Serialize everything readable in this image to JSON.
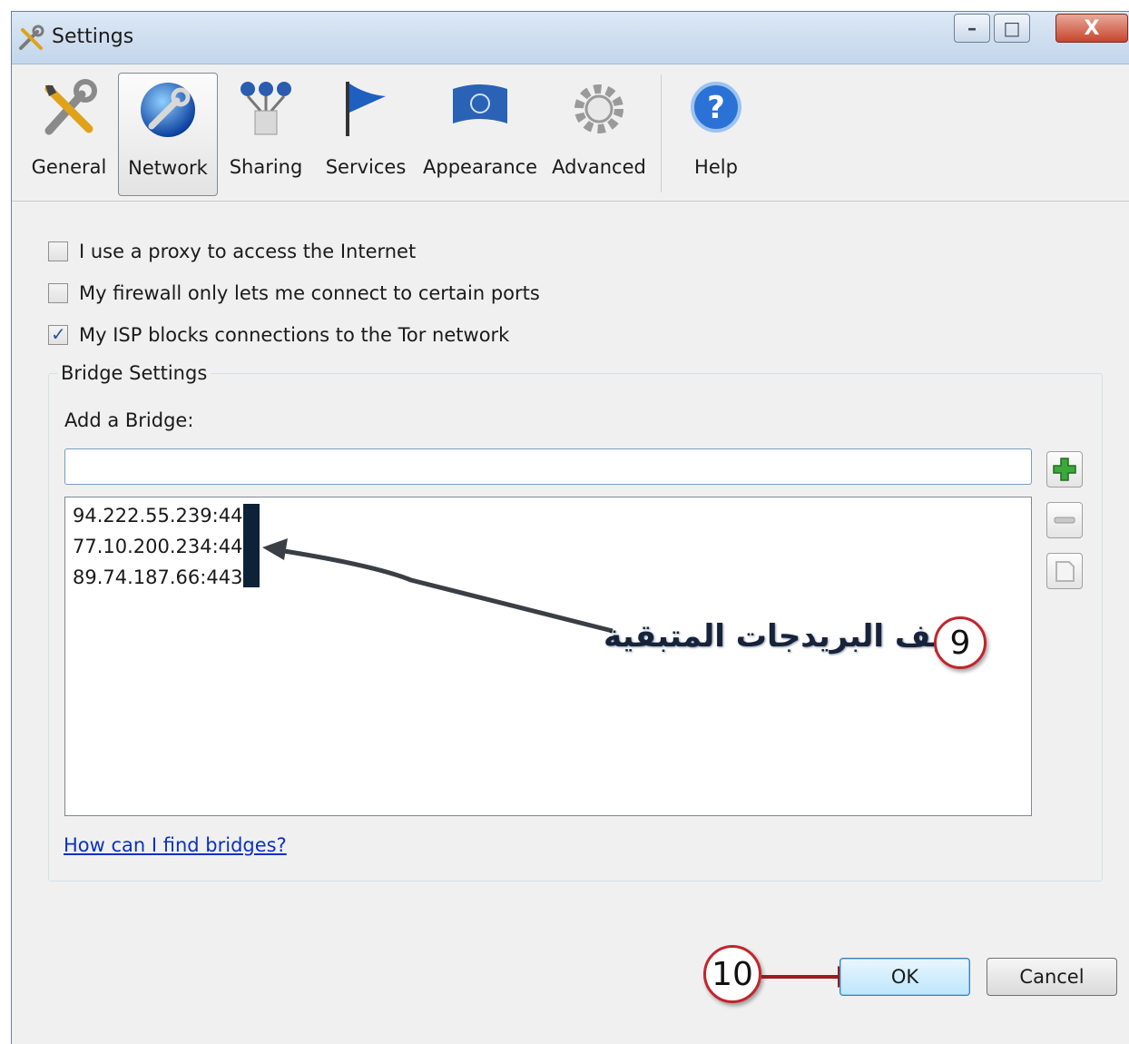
{
  "window": {
    "title": "Settings",
    "controls": {
      "minimize": "–",
      "maximize": "□",
      "close": "X"
    }
  },
  "toolbar": {
    "items": [
      {
        "label": "General",
        "icon": "wrench-screwdriver-icon",
        "selected": false
      },
      {
        "label": "Network",
        "icon": "globe-wrench-icon",
        "selected": true
      },
      {
        "label": "Sharing",
        "icon": "network-sharing-icon",
        "selected": false
      },
      {
        "label": "Services",
        "icon": "flag-icon",
        "selected": false
      },
      {
        "label": "Appearance",
        "icon": "un-flag-icon",
        "selected": false
      },
      {
        "label": "Advanced",
        "icon": "gear-icon",
        "selected": false
      },
      {
        "label": "Help",
        "icon": "help-icon",
        "selected": false
      }
    ]
  },
  "options": {
    "proxy": {
      "label": "I use a proxy to access the Internet",
      "checked": false
    },
    "firewall": {
      "label": "My firewall only lets me connect to certain ports",
      "checked": false
    },
    "isp": {
      "label": "My ISP blocks connections to the Tor network",
      "checked": true
    }
  },
  "bridge_settings": {
    "group_title": "Bridge Settings",
    "add_label": "Add a Bridge:",
    "input_value": "",
    "bridges": [
      "94.222.55.239:443",
      "77.10.200.234:443",
      "89.74.187.66:443"
    ],
    "help_link": "How can I find bridges?"
  },
  "annotations": {
    "step9_number": "9",
    "step9_text": "نضيف البريدجات المتبقية",
    "step10_number": "10"
  },
  "buttons": {
    "ok": "OK",
    "cancel": "Cancel"
  },
  "colors": {
    "annotation_ring": "#c3242b",
    "link": "#0b30c7",
    "ok_button": "#bde6fd"
  }
}
